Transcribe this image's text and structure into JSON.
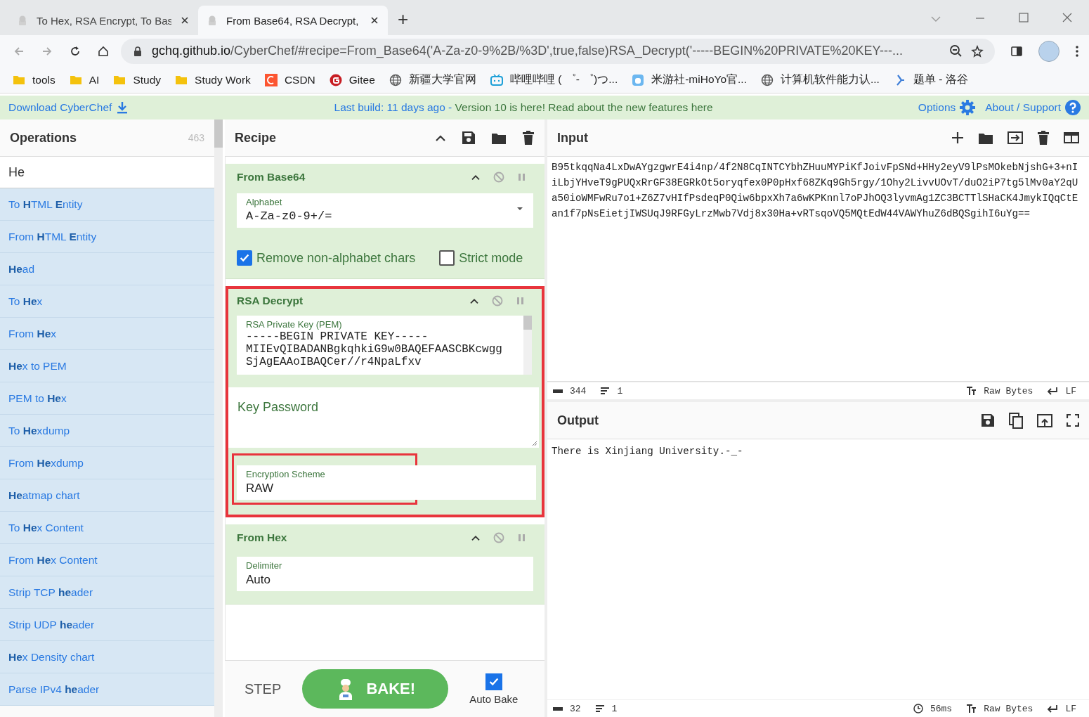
{
  "browser": {
    "tabs": [
      {
        "title": "To Hex, RSA Encrypt, To Bas",
        "selected": false
      },
      {
        "title": "From Base64, RSA Decrypt,",
        "selected": true
      }
    ],
    "new_tab": "+",
    "url_host": "gchq.github.io",
    "url_path": "/CyberChef/#recipe=From_Base64('A-Za-z0-9%2B/%3D',true,false)RSA_Decrypt('-----BEGIN%20PRIVATE%20KEY---...",
    "bookmarks": [
      {
        "label": "tools",
        "kind": "folder"
      },
      {
        "label": "AI",
        "kind": "folder"
      },
      {
        "label": "Study",
        "kind": "folder"
      },
      {
        "label": "Study Work",
        "kind": "folder"
      },
      {
        "label": "CSDN",
        "kind": "csdn"
      },
      {
        "label": "Gitee",
        "kind": "gitee"
      },
      {
        "label": "新疆大学官网",
        "kind": "globe"
      },
      {
        "label": "哔哩哔哩 ( ゜- ゜)つ...",
        "kind": "tv"
      },
      {
        "label": "米游社-miHoYo官...",
        "kind": "app"
      },
      {
        "label": "计算机软件能力认...",
        "kind": "globe"
      },
      {
        "label": "题单 - 洛谷",
        "kind": "luogu"
      }
    ]
  },
  "banner": {
    "download": "Download CyberChef",
    "notice": "Last build: 11 days ago - ",
    "notice_link": "Version 10 is here! Read about the new features here",
    "options": "Options",
    "about": "About / Support"
  },
  "operations": {
    "title": "Operations",
    "count": "463",
    "search": "He",
    "items": [
      "To **H**TML **E**ntity",
      "From **H**TML **E**ntity",
      "**He**ad",
      "To **He**x",
      "From **He**x",
      "**He**x to PEM",
      "PEM to **He**x",
      "To **He**xdump",
      "From **He**xdump",
      "**He**atmap chart",
      "To **He**x Content",
      "From **He**x Content",
      "Strip TCP **he**ader",
      "Strip UDP **he**ader",
      "**He**x Density chart",
      "Parse IPv4 **he**ader"
    ]
  },
  "recipe": {
    "title": "Recipe",
    "ops": [
      {
        "name": "From Base64",
        "highlighted": false,
        "args": [
          {
            "kind": "dropdown",
            "label": "Alphabet",
            "value": "A-Za-z0-9+/="
          },
          {
            "kind": "checkbox",
            "label": "Remove non-alphabet chars",
            "checked": true
          },
          {
            "kind": "checkbox",
            "label": "Strict mode",
            "checked": false
          }
        ]
      },
      {
        "name": "RSA Decrypt",
        "highlighted": true,
        "args": [
          {
            "kind": "textarea",
            "label": "RSA Private Key (PEM)",
            "lines": [
              "-----BEGIN PRIVATE KEY-----",
              "MIIEvQIBADANBgkqhkiG9w0BAQEFAASCBKcwgg",
              "SjAgEAAoIBAQCer//r4NpaLfxv"
            ]
          },
          {
            "kind": "password",
            "placeholder": "Key Password"
          },
          {
            "kind": "option",
            "label": "Encryption Scheme",
            "value": "RAW",
            "highlighted": true
          }
        ]
      },
      {
        "name": "From Hex",
        "highlighted": false,
        "args": [
          {
            "kind": "option",
            "label": "Delimiter",
            "value": "Auto",
            "highlighted": false
          }
        ]
      }
    ]
  },
  "controls": {
    "step": "STEP",
    "bake": "BAKE!",
    "auto_bake": {
      "label": "Auto Bake",
      "checked": true
    }
  },
  "input": {
    "title": "Input",
    "text": "B95tkqqNa4LxDwAYgzgwrE4i4np/4f2N8CqINTCYbhZHuuMYPiKfJoivFpSNd+HHy2eyV9lPsMOkebNjshG+3+nIiLbjYHveT9gPUQxRrGF38EGRkOt5oryqfex0P0pHxf68ZKq9Gh5rgy/1Ohy2LivvUOvT/duO2iP7tg5lMv0aY2qUa50ioWMFwRu7o1+Z6Z7vHIfPsdeqP0Qiw6bpxXh7a6wKPKnnl7oPJhOQ3lyvmAg1ZC3BCTTlSHaCK4JmykIQqCtEan1f7pNsEietjIWSUqJ9RFGyLrzMwb7Vdj8x30Ha+vRTsqoVQ5MQtEdW44VAWYhuZ6dBQSgihI6uYg==",
    "status": {
      "length": "344",
      "lines": "1",
      "encoding": "Raw Bytes",
      "eol": "LF"
    }
  },
  "output": {
    "title": "Output",
    "text": "There is Xinjiang University.-_-",
    "status": {
      "length": "32",
      "lines": "1",
      "time": "56ms",
      "encoding": "Raw Bytes",
      "eol": "LF"
    }
  }
}
